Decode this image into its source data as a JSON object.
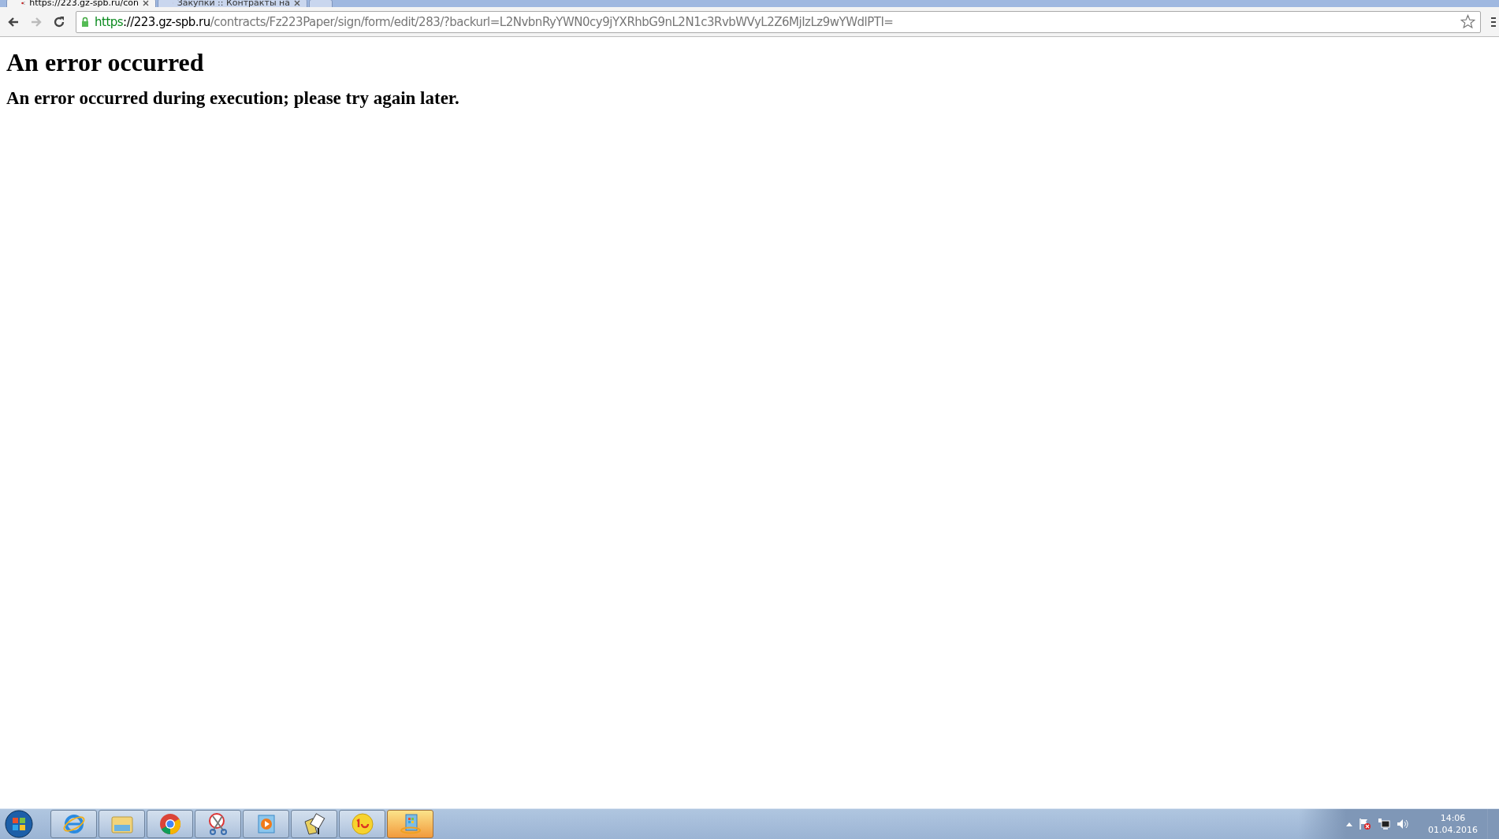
{
  "browser": {
    "tabs": [
      {
        "label": "https://223.gz-spb.ru/con",
        "selected": true
      },
      {
        "label": "Закупки :: Контракты на",
        "selected": false
      }
    ],
    "address": {
      "scheme": "https",
      "host": "://223.gz-spb.ru",
      "path": "/contracts/Fz223Paper/sign/form/edit/283/?backurl=L2NvbnRyYWN0cy9jYXRhbG9nL2N1c3RvbWVyL2Z6MjIzLz9wYWdlPTI="
    }
  },
  "page": {
    "heading": "An error occurred",
    "message": "An error occurred during execution; please try again later."
  },
  "taskbar": {
    "items": [
      {
        "kind": "ie",
        "selected": false
      },
      {
        "kind": "folder",
        "selected": false
      },
      {
        "kind": "chrome",
        "selected": false
      },
      {
        "kind": "scissors",
        "selected": false
      },
      {
        "kind": "player",
        "selected": false
      },
      {
        "kind": "document",
        "selected": false
      },
      {
        "kind": "onec",
        "selected": false
      },
      {
        "kind": "update",
        "selected": true
      }
    ],
    "clock": {
      "time": "14:06",
      "date": "01.04.2016"
    }
  }
}
